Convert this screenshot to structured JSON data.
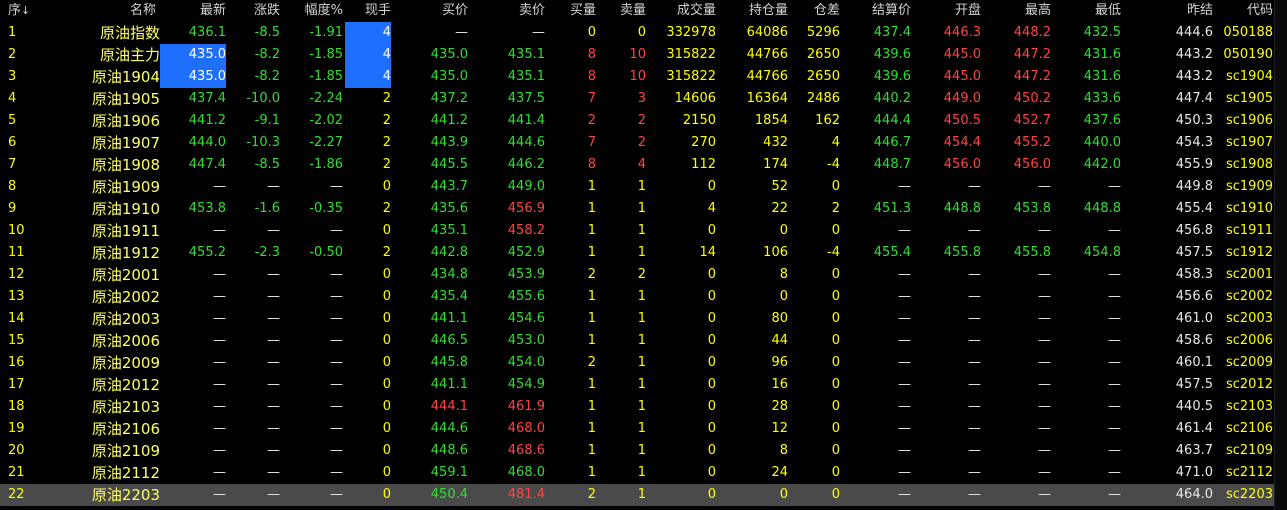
{
  "headers": {
    "seq": "序",
    "seq_arrow": "↓",
    "name": "名称",
    "last": "最新",
    "change": "涨跌",
    "pct": "幅度%",
    "cur": "现手",
    "bid": "买价",
    "ask": "卖价",
    "bidvol": "买量",
    "askvol": "卖量",
    "volume": "成交量",
    "oi": "持仓量",
    "oichg": "仓差",
    "settle": "结算价",
    "open": "开盘",
    "high": "最高",
    "low": "最低",
    "prev": "昨结",
    "code": "代码"
  },
  "rows": [
    {
      "seq": "1",
      "name": "原油指数",
      "last": "436.1",
      "change": "-8.5",
      "pct": "-1.91",
      "cur": "4",
      "bid": "—",
      "ask": "—",
      "bidvol": "0",
      "askvol": "0",
      "volume": "332978",
      "oi": "64086",
      "oichg": "5296",
      "settle": "437.4",
      "open": "446.3",
      "high": "448.2",
      "low": "432.5",
      "prev": "444.6",
      "code": "050188"
    },
    {
      "seq": "2",
      "name": "原油主力",
      "last": "435.0",
      "change": "-8.2",
      "pct": "-1.85",
      "cur": "4",
      "bid": "435.0",
      "ask": "435.1",
      "bidvol": "8",
      "askvol": "10",
      "volume": "315822",
      "oi": "44766",
      "oichg": "2650",
      "settle": "439.6",
      "open": "445.0",
      "high": "447.2",
      "low": "431.6",
      "prev": "443.2",
      "code": "050190"
    },
    {
      "seq": "3",
      "name": "原油1904",
      "last": "435.0",
      "change": "-8.2",
      "pct": "-1.85",
      "cur": "4",
      "bid": "435.0",
      "ask": "435.1",
      "bidvol": "8",
      "askvol": "10",
      "volume": "315822",
      "oi": "44766",
      "oichg": "2650",
      "settle": "439.6",
      "open": "445.0",
      "high": "447.2",
      "low": "431.6",
      "prev": "443.2",
      "code": "sc1904"
    },
    {
      "seq": "4",
      "name": "原油1905",
      "last": "437.4",
      "change": "-10.0",
      "pct": "-2.24",
      "cur": "2",
      "bid": "437.2",
      "ask": "437.5",
      "bidvol": "7",
      "askvol": "3",
      "volume": "14606",
      "oi": "16364",
      "oichg": "2486",
      "settle": "440.2",
      "open": "449.0",
      "high": "450.2",
      "low": "433.6",
      "prev": "447.4",
      "code": "sc1905"
    },
    {
      "seq": "5",
      "name": "原油1906",
      "last": "441.2",
      "change": "-9.1",
      "pct": "-2.02",
      "cur": "2",
      "bid": "441.2",
      "ask": "441.4",
      "bidvol": "2",
      "askvol": "2",
      "volume": "2150",
      "oi": "1854",
      "oichg": "162",
      "settle": "444.4",
      "open": "450.5",
      "high": "452.7",
      "low": "437.6",
      "prev": "450.3",
      "code": "sc1906"
    },
    {
      "seq": "6",
      "name": "原油1907",
      "last": "444.0",
      "change": "-10.3",
      "pct": "-2.27",
      "cur": "2",
      "bid": "443.9",
      "ask": "444.6",
      "bidvol": "7",
      "askvol": "2",
      "volume": "270",
      "oi": "432",
      "oichg": "4",
      "settle": "446.7",
      "open": "454.4",
      "high": "455.2",
      "low": "440.0",
      "prev": "454.3",
      "code": "sc1907"
    },
    {
      "seq": "7",
      "name": "原油1908",
      "last": "447.4",
      "change": "-8.5",
      "pct": "-1.86",
      "cur": "2",
      "bid": "445.5",
      "ask": "446.2",
      "bidvol": "8",
      "askvol": "4",
      "volume": "112",
      "oi": "174",
      "oichg": "-4",
      "settle": "448.7",
      "open": "456.0",
      "high": "456.0",
      "low": "442.0",
      "prev": "455.9",
      "code": "sc1908"
    },
    {
      "seq": "8",
      "name": "原油1909",
      "last": "—",
      "change": "—",
      "pct": "—",
      "cur": "0",
      "bid": "443.7",
      "ask": "449.0",
      "bidvol": "1",
      "askvol": "1",
      "volume": "0",
      "oi": "52",
      "oichg": "0",
      "settle": "—",
      "open": "—",
      "high": "—",
      "low": "—",
      "prev": "449.8",
      "code": "sc1909"
    },
    {
      "seq": "9",
      "name": "原油1910",
      "last": "453.8",
      "change": "-1.6",
      "pct": "-0.35",
      "cur": "2",
      "bid": "435.6",
      "ask": "456.9",
      "bidvol": "1",
      "askvol": "1",
      "volume": "4",
      "oi": "22",
      "oichg": "2",
      "settle": "451.3",
      "open": "448.8",
      "high": "453.8",
      "low": "448.8",
      "prev": "455.4",
      "code": "sc1910"
    },
    {
      "seq": "10",
      "name": "原油1911",
      "last": "—",
      "change": "—",
      "pct": "—",
      "cur": "0",
      "bid": "435.1",
      "ask": "458.2",
      "bidvol": "1",
      "askvol": "1",
      "volume": "0",
      "oi": "0",
      "oichg": "0",
      "settle": "—",
      "open": "—",
      "high": "—",
      "low": "—",
      "prev": "456.8",
      "code": "sc1911"
    },
    {
      "seq": "11",
      "name": "原油1912",
      "last": "455.2",
      "change": "-2.3",
      "pct": "-0.50",
      "cur": "2",
      "bid": "442.8",
      "ask": "452.9",
      "bidvol": "1",
      "askvol": "1",
      "volume": "14",
      "oi": "106",
      "oichg": "-4",
      "settle": "455.4",
      "open": "455.8",
      "high": "455.8",
      "low": "454.8",
      "prev": "457.5",
      "code": "sc1912"
    },
    {
      "seq": "12",
      "name": "原油2001",
      "last": "—",
      "change": "—",
      "pct": "—",
      "cur": "0",
      "bid": "434.8",
      "ask": "453.9",
      "bidvol": "2",
      "askvol": "2",
      "volume": "0",
      "oi": "8",
      "oichg": "0",
      "settle": "—",
      "open": "—",
      "high": "—",
      "low": "—",
      "prev": "458.3",
      "code": "sc2001"
    },
    {
      "seq": "13",
      "name": "原油2002",
      "last": "—",
      "change": "—",
      "pct": "—",
      "cur": "0",
      "bid": "435.4",
      "ask": "455.6",
      "bidvol": "1",
      "askvol": "1",
      "volume": "0",
      "oi": "0",
      "oichg": "0",
      "settle": "—",
      "open": "—",
      "high": "—",
      "low": "—",
      "prev": "456.6",
      "code": "sc2002"
    },
    {
      "seq": "14",
      "name": "原油2003",
      "last": "—",
      "change": "—",
      "pct": "—",
      "cur": "0",
      "bid": "441.1",
      "ask": "454.6",
      "bidvol": "1",
      "askvol": "1",
      "volume": "0",
      "oi": "80",
      "oichg": "0",
      "settle": "—",
      "open": "—",
      "high": "—",
      "low": "—",
      "prev": "461.0",
      "code": "sc2003"
    },
    {
      "seq": "15",
      "name": "原油2006",
      "last": "—",
      "change": "—",
      "pct": "—",
      "cur": "0",
      "bid": "446.5",
      "ask": "453.0",
      "bidvol": "1",
      "askvol": "1",
      "volume": "0",
      "oi": "44",
      "oichg": "0",
      "settle": "—",
      "open": "—",
      "high": "—",
      "low": "—",
      "prev": "458.6",
      "code": "sc2006"
    },
    {
      "seq": "16",
      "name": "原油2009",
      "last": "—",
      "change": "—",
      "pct": "—",
      "cur": "0",
      "bid": "445.8",
      "ask": "454.0",
      "bidvol": "2",
      "askvol": "1",
      "volume": "0",
      "oi": "96",
      "oichg": "0",
      "settle": "—",
      "open": "—",
      "high": "—",
      "low": "—",
      "prev": "460.1",
      "code": "sc2009"
    },
    {
      "seq": "17",
      "name": "原油2012",
      "last": "—",
      "change": "—",
      "pct": "—",
      "cur": "0",
      "bid": "441.1",
      "ask": "454.9",
      "bidvol": "1",
      "askvol": "1",
      "volume": "0",
      "oi": "16",
      "oichg": "0",
      "settle": "—",
      "open": "—",
      "high": "—",
      "low": "—",
      "prev": "457.5",
      "code": "sc2012"
    },
    {
      "seq": "18",
      "name": "原油2103",
      "last": "—",
      "change": "—",
      "pct": "—",
      "cur": "0",
      "bid": "444.1",
      "ask": "461.9",
      "bidvol": "1",
      "askvol": "1",
      "volume": "0",
      "oi": "28",
      "oichg": "0",
      "settle": "—",
      "open": "—",
      "high": "—",
      "low": "—",
      "prev": "440.5",
      "code": "sc2103"
    },
    {
      "seq": "19",
      "name": "原油2106",
      "last": "—",
      "change": "—",
      "pct": "—",
      "cur": "0",
      "bid": "444.6",
      "ask": "468.0",
      "bidvol": "1",
      "askvol": "1",
      "volume": "0",
      "oi": "12",
      "oichg": "0",
      "settle": "—",
      "open": "—",
      "high": "—",
      "low": "—",
      "prev": "461.4",
      "code": "sc2106"
    },
    {
      "seq": "20",
      "name": "原油2109",
      "last": "—",
      "change": "—",
      "pct": "—",
      "cur": "0",
      "bid": "448.6",
      "ask": "468.6",
      "bidvol": "1",
      "askvol": "1",
      "volume": "0",
      "oi": "8",
      "oichg": "0",
      "settle": "—",
      "open": "—",
      "high": "—",
      "low": "—",
      "prev": "463.7",
      "code": "sc2109"
    },
    {
      "seq": "21",
      "name": "原油2112",
      "last": "—",
      "change": "—",
      "pct": "—",
      "cur": "0",
      "bid": "459.1",
      "ask": "468.0",
      "bidvol": "1",
      "askvol": "1",
      "volume": "0",
      "oi": "24",
      "oichg": "0",
      "settle": "—",
      "open": "—",
      "high": "—",
      "low": "—",
      "prev": "471.0",
      "code": "sc2112"
    },
    {
      "seq": "22",
      "name": "原油2203",
      "last": "—",
      "change": "—",
      "pct": "—",
      "cur": "0",
      "bid": "450.4",
      "ask": "481.4",
      "bidvol": "2",
      "askvol": "1",
      "volume": "0",
      "oi": "0",
      "oichg": "0",
      "settle": "—",
      "open": "—",
      "high": "—",
      "low": "—",
      "prev": "464.0",
      "code": "sc2203"
    }
  ],
  "selected_row": 22,
  "colors": {
    "up": "#ff4444",
    "down": "#33dd33",
    "neutral": "#e8e8e8",
    "yellow": "#ffff00",
    "cyan": "#33dddd",
    "highlight": "#1f6fff",
    "selected": "#4a4a4a"
  }
}
